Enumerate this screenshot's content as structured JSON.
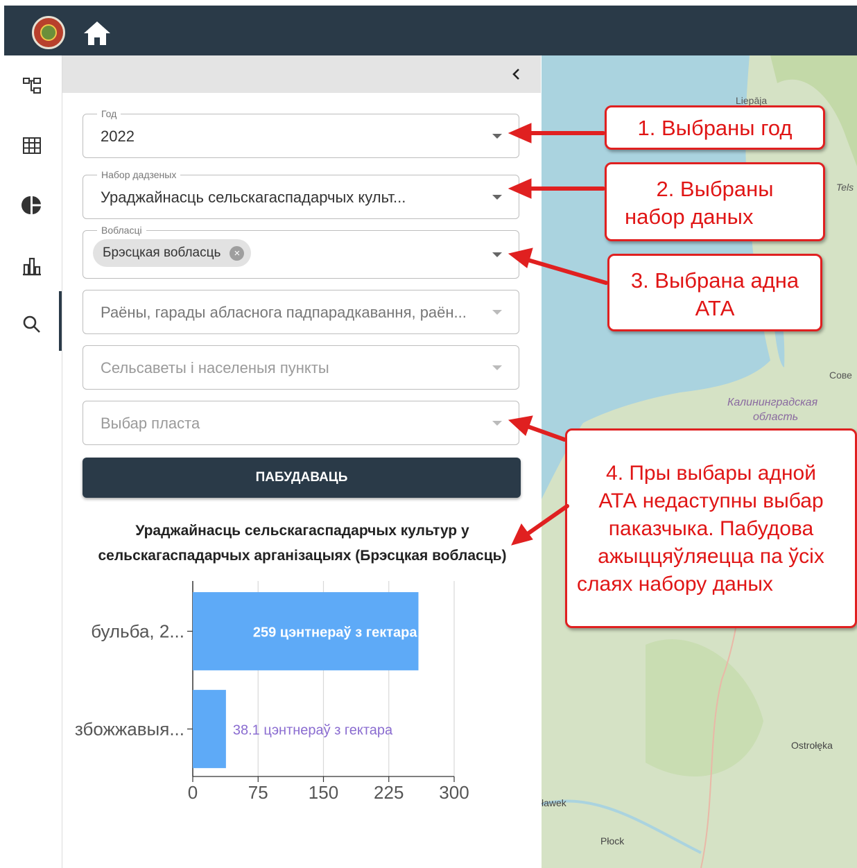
{
  "app": {
    "logo": "coat-of-arms-logo",
    "home_icon": "home-icon"
  },
  "rail": {
    "items": [
      "layers-tree-icon",
      "table-icon",
      "pie-chart-icon",
      "bar-chart-icon",
      "search-icon"
    ],
    "active": "bar-chart-icon"
  },
  "panel": {
    "collapse_icon": "chevron-left-icon",
    "year": {
      "label": "Год",
      "value": "2022"
    },
    "dataset": {
      "label": "Набор дадзеных",
      "value": "Ураджайнасць сельскагаспадарчых культ..."
    },
    "regions": {
      "label": "Вобласці",
      "chip": "Брэсцкая вобласць"
    },
    "districts": {
      "placeholder": "Раёны, гарады абласнога падпарадкавання, раён..."
    },
    "villages": {
      "placeholder": "Сельсаветы і населеныя пункты"
    },
    "layer": {
      "placeholder": "Выбар пласта"
    },
    "build_button": "ПАБУДАВАЦЬ"
  },
  "chart_data": {
    "type": "bar",
    "orientation": "horizontal",
    "title_line1": "Ураджайнасць сельскагаспадарчых культур у",
    "title_line2": "сельскагаспадарчых арганізацыях (Брэсцкая вобласць)",
    "categories": [
      "бульба, 2...",
      "збожжавыя..."
    ],
    "values": [
      259,
      38.1
    ],
    "data_labels": [
      "259 цэнтнераў з гектара",
      "38.1 цэнтнераў з гектара"
    ],
    "xlim": [
      0,
      300
    ],
    "xticks": [
      "0",
      "75",
      "150",
      "225",
      "300"
    ],
    "grid": true,
    "bar_color": "#5eaaf7"
  },
  "map": {
    "labels": [
      "Liepāja",
      "Tels",
      "Сове",
      "Калининградская",
      "область",
      "Ostrołęka",
      "ławek",
      "Płock"
    ],
    "colors": {
      "sea": "#aad3df",
      "land": "#d5e2c5"
    }
  },
  "callouts": {
    "c1": "1. Выбраны год",
    "c2a": "2. Выбраны",
    "c2b": "набор даных",
    "c3a": "3. Выбрана адна",
    "c3b": "АТА",
    "c4a": "4. Пры выбары адной",
    "c4b": "АТА недаступны  выбар",
    "c4c": "паказчыка. Пабудова",
    "c4d": "ажыццяўляецца па ўсіх",
    "c4e": "слаях набору даных"
  }
}
